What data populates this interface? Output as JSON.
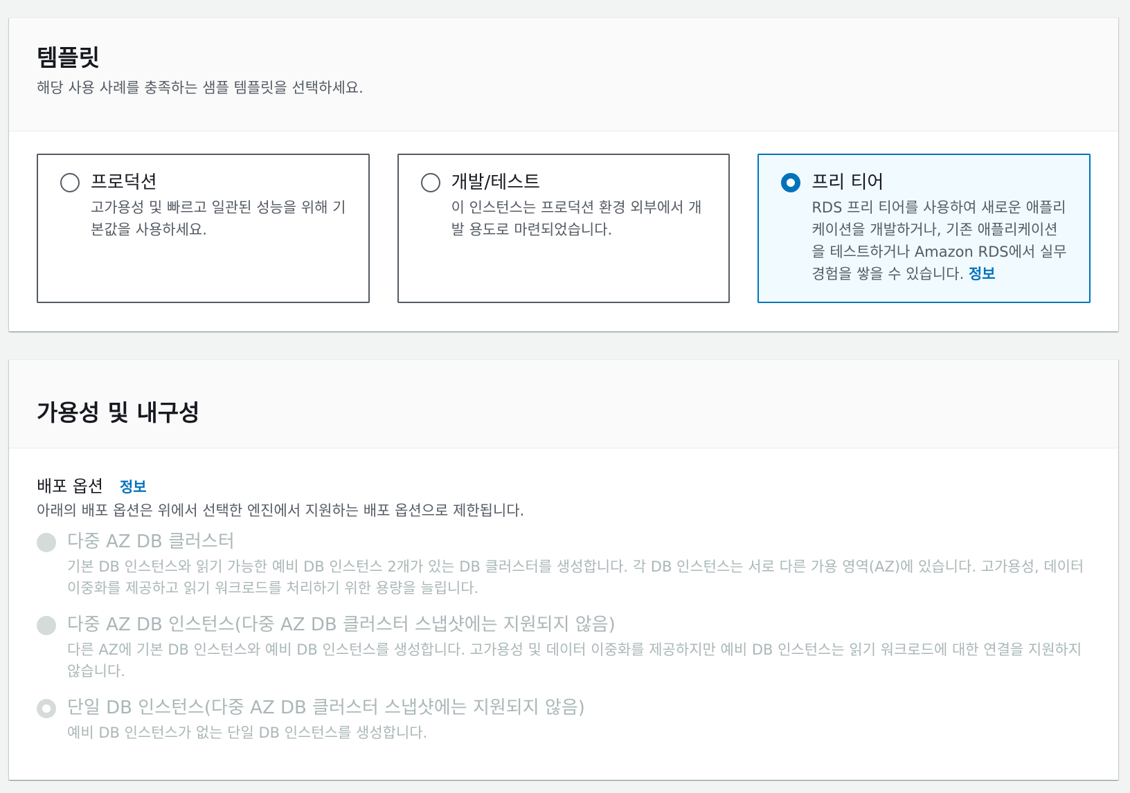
{
  "templates": {
    "title": "템플릿",
    "description": "해당 사용 사례를 충족하는 샘플 템플릿을 선택하세요.",
    "tiles": [
      {
        "title": "프로덕션",
        "description": "고가용성 및 빠르고 일관된 성능을 위해 기본값을 사용하세요.",
        "selected": false
      },
      {
        "title": "개발/테스트",
        "description": "이 인스턴스는 프로덕션 환경 외부에서 개발 용도로 마련되었습니다.",
        "selected": false
      },
      {
        "title": "프리 티어",
        "description": "RDS 프리 티어를 사용하여 새로운 애플리케이션을 개발하거나, 기존 애플리케이션을 테스트하거나 Amazon RDS에서 실무 경험을 쌓을 수 있습니다.",
        "info_link": "정보",
        "selected": true
      }
    ]
  },
  "availability": {
    "title": "가용성 및 내구성",
    "deployment": {
      "label": "배포 옵션",
      "info_link": "정보",
      "description": "아래의 배포 옵션은 위에서 선택한 엔진에서 지원하는 배포 옵션으로 제한됩니다.",
      "options": [
        {
          "title": "다중 AZ DB 클러스터",
          "description": "기본 DB 인스턴스와 읽기 가능한 예비 DB 인스턴스 2개가 있는 DB 클러스터를 생성합니다. 각 DB 인스턴스는 서로 다른 가용 영역(AZ)에 있습니다. 고가용성, 데이터 이중화를 제공하고 읽기 워크로드를 처리하기 위한 용량을 늘립니다.",
          "disabled": true,
          "checked": false
        },
        {
          "title": "다중 AZ DB 인스턴스(다중 AZ DB 클러스터 스냅샷에는 지원되지 않음)",
          "description": "다른 AZ에 기본 DB 인스턴스와 예비 DB 인스턴스를 생성합니다. 고가용성 및 데이터 이중화를 제공하지만 예비 DB 인스턴스는 읽기 워크로드에 대한 연결을 지원하지 않습니다.",
          "disabled": true,
          "checked": false
        },
        {
          "title": "단일 DB 인스턴스(다중 AZ DB 클러스터 스냅샷에는 지원되지 않음)",
          "description": "예비 DB 인스턴스가 없는 단일 DB 인스턴스를 생성합니다.",
          "disabled": true,
          "checked": true
        }
      ]
    }
  },
  "colors": {
    "accent": "#0073bb",
    "selected_tile_bg": "#f1faff",
    "disabled_text": "#aab7b8",
    "secondary_text": "#545b64"
  }
}
